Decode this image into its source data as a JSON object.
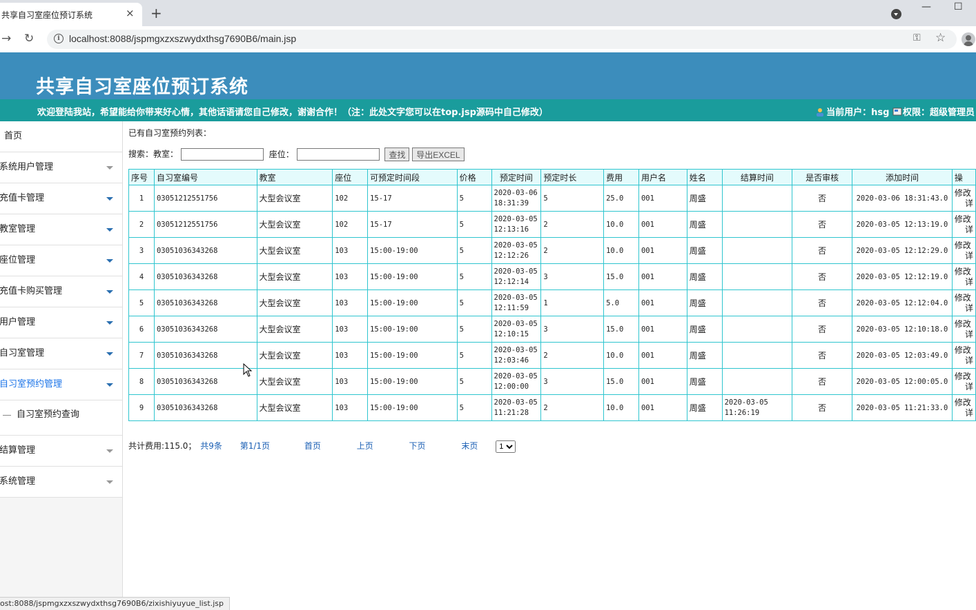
{
  "browser": {
    "tab_title": "共享自习室座位预订系统",
    "tab_close": "×",
    "new_tab": "+",
    "minimize": "—",
    "maximize": "☐",
    "url": "localhost:8088/jspmgxzxszwydxthsg7690B6/main.jsp",
    "status_url": "ost:8088/jspmgxzxszwydxthsg7690B6/zixishiyuyue_list.jsp"
  },
  "header": {
    "title": "共享自习室座位预订系统",
    "welcome": "欢迎登陆我站，希望能给你带来好心情，其他话语请您自己修改，谢谢合作！（注：此处文字您可以在top.jsp源码中自己修改）",
    "current_user_label": "当前用户：hsg",
    "role_label": "权限：超级管理员"
  },
  "sidebar": {
    "home": "首页",
    "items": [
      {
        "label": "系统用户管理"
      },
      {
        "label": "充值卡管理"
      },
      {
        "label": "教室管理"
      },
      {
        "label": "座位管理"
      },
      {
        "label": "充值卡购买管理"
      },
      {
        "label": "用户管理"
      },
      {
        "label": "自习室管理"
      },
      {
        "label": "自习室预约管理"
      },
      {
        "label": "结算管理"
      },
      {
        "label": "系统管理"
      }
    ],
    "sub_item": "自习室预约查询"
  },
  "main": {
    "caption": "已有自习室预约列表：",
    "search_label": "搜索：",
    "classroom_label": "教室：",
    "seat_label": "座位：",
    "classroom_value": "",
    "seat_value": "",
    "search_button": "查找",
    "export_button": "导出EXCEL",
    "columns": [
      "序号",
      "自习室编号",
      "教室",
      "座位",
      "可预定时间段",
      "价格",
      "预定时间",
      "预定时长",
      "费用",
      "用户名",
      "姓名",
      "结算时间",
      "是否审核",
      "添加时间",
      "操"
    ],
    "rows": [
      [
        "1",
        "03051212551756",
        "大型会议室",
        "102",
        "15-17",
        "5",
        "2020-03-06 18:31:39",
        "5",
        "25.0",
        "001",
        "周盛",
        "",
        "否",
        "2020-03-06 18:31:43.0"
      ],
      [
        "2",
        "03051212551756",
        "大型会议室",
        "102",
        "15-17",
        "5",
        "2020-03-05 12:13:16",
        "2",
        "10.0",
        "001",
        "周盛",
        "",
        "否",
        "2020-03-05 12:13:19.0"
      ],
      [
        "3",
        "03051036343268",
        "大型会议室",
        "103",
        "15:00-19:00",
        "5",
        "2020-03-05 12:12:26",
        "2",
        "10.0",
        "001",
        "周盛",
        "",
        "否",
        "2020-03-05 12:12:29.0"
      ],
      [
        "4",
        "03051036343268",
        "大型会议室",
        "103",
        "15:00-19:00",
        "5",
        "2020-03-05 12:12:14",
        "3",
        "15.0",
        "001",
        "周盛",
        "",
        "否",
        "2020-03-05 12:12:19.0"
      ],
      [
        "5",
        "03051036343268",
        "大型会议室",
        "103",
        "15:00-19:00",
        "5",
        "2020-03-05 12:11:59",
        "1",
        "5.0",
        "001",
        "周盛",
        "",
        "否",
        "2020-03-05 12:12:04.0"
      ],
      [
        "6",
        "03051036343268",
        "大型会议室",
        "103",
        "15:00-19:00",
        "5",
        "2020-03-05 12:10:15",
        "3",
        "15.0",
        "001",
        "周盛",
        "",
        "否",
        "2020-03-05 12:10:18.0"
      ],
      [
        "7",
        "03051036343268",
        "大型会议室",
        "103",
        "15:00-19:00",
        "5",
        "2020-03-05 12:03:46",
        "2",
        "10.0",
        "001",
        "周盛",
        "",
        "否",
        "2020-03-05 12:03:49.0"
      ],
      [
        "8",
        "03051036343268",
        "大型会议室",
        "103",
        "15:00-19:00",
        "5",
        "2020-03-05 12:00:00",
        "3",
        "15.0",
        "001",
        "周盛",
        "",
        "否",
        "2020-03-05 12:00:05.0"
      ],
      [
        "9",
        "03051036343268",
        "大型会议室",
        "103",
        "15:00-19:00",
        "5",
        "2020-03-05 11:21:28",
        "2",
        "10.0",
        "001",
        "周盛",
        "2020-03-05 11:26:19",
        "否",
        "2020-03-05 11:21:33.0"
      ]
    ],
    "op_edit": "修改",
    "op_detail": "详"
  },
  "pager": {
    "total_fee": "共计费用:115.0；",
    "total_count": "共9条",
    "page_info": "第1/1页",
    "first": "首页",
    "prev": "上页",
    "next": "下页",
    "last": "末页",
    "page_select": "1"
  }
}
